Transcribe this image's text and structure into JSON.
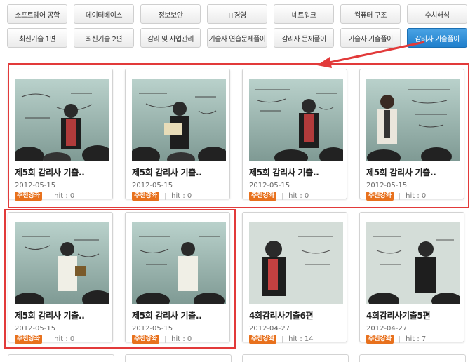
{
  "tabs_row1": [
    {
      "label": "소프트웨어 공학"
    },
    {
      "label": "데이터베이스"
    },
    {
      "label": "정보보안"
    },
    {
      "label": "IT경영"
    },
    {
      "label": "네트워크"
    },
    {
      "label": "컴퓨터 구조"
    },
    {
      "label": "수치해석"
    }
  ],
  "tabs_row2": [
    {
      "label": "최신기술 1편"
    },
    {
      "label": "최신기술 2편"
    },
    {
      "label": "감리 및 사업관리"
    },
    {
      "label": "기술사 연습문제풀이"
    },
    {
      "label": "감리사 문제풀이"
    },
    {
      "label": "기술사 기출풀이"
    },
    {
      "label": "감리사 기출풀이",
      "active": true
    }
  ],
  "cards": [
    {
      "title": "제5회 감리사 기출..",
      "date": "2012-05-15",
      "badge": "추천강좌",
      "hit": "hit : 0"
    },
    {
      "title": "제5회 감리사 기출..",
      "date": "2012-05-15",
      "badge": "추천강좌",
      "hit": "hit : 0"
    },
    {
      "title": "제5회 감리사 기출..",
      "date": "2012-05-15",
      "badge": "추천강좌",
      "hit": "hit : 0"
    },
    {
      "title": "제5회 감리사 기출..",
      "date": "2012-05-15",
      "badge": "추천강좌",
      "hit": "hit : 0"
    },
    {
      "title": "제5회 감리사 기출..",
      "date": "2012-05-15",
      "badge": "추천강좌",
      "hit": "hit : 0"
    },
    {
      "title": "제5회 감리사 기출..",
      "date": "2012-05-15",
      "badge": "추천강좌",
      "hit": "hit : 0"
    },
    {
      "title": "4회감리사기출6편",
      "date": "2012-04-27",
      "badge": "추천강좌",
      "hit": "hit : 14"
    },
    {
      "title": "4회감리사기출5편",
      "date": "2012-04-27",
      "badge": "추천강좌",
      "hit": "hit : 7"
    }
  ],
  "colors": {
    "active_tab": "#1f7fcc",
    "badge": "#e8711d",
    "highlight": "#e23a3a"
  }
}
